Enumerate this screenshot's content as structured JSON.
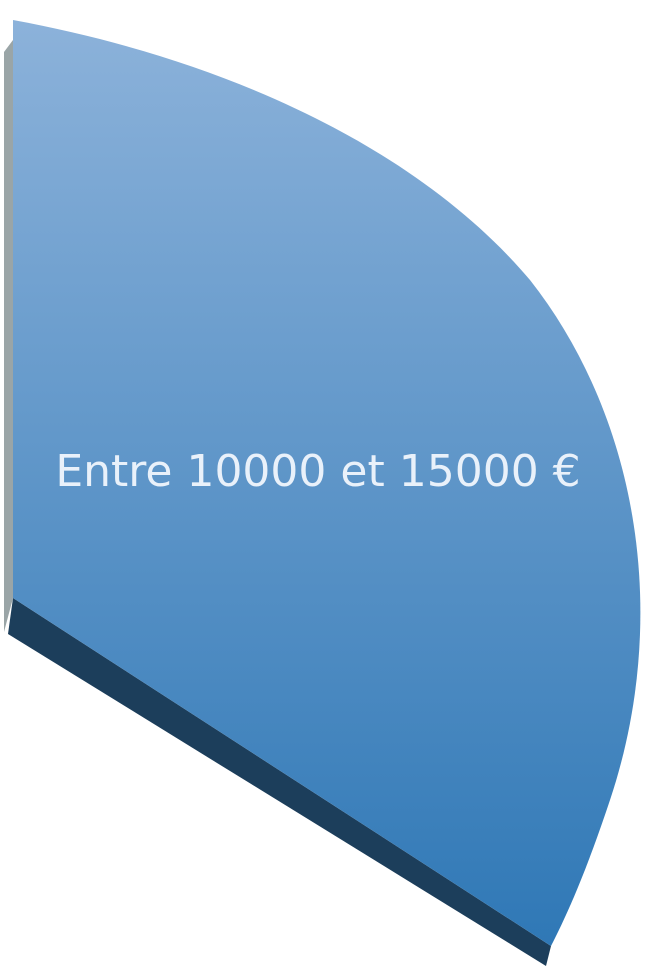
{
  "chart_data": {
    "type": "pie",
    "style": "3d-exploded-slice",
    "slices": [
      {
        "label": "Entre 10000 et 15000 €",
        "color_top": "#8cb2da",
        "color_bottom": "#2f78b6",
        "color_side": "#1c3e5b",
        "color_edge": "#9aa5a7"
      }
    ]
  }
}
